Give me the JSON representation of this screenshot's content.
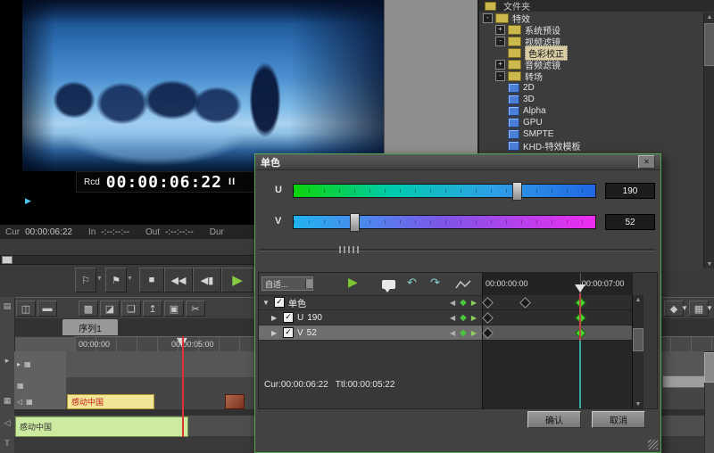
{
  "colors": {
    "dialog_border_green": "#55a555",
    "playhead_red": "#e03232",
    "keyframe_green": "#46d42e",
    "clip_yellow": "#f0e695",
    "clip_green": "#cdeba0",
    "tree_selection": "#d8cda2"
  },
  "preview": {
    "rcd_label": "Rcd",
    "timecode": "00:00:06:22",
    "pause_icon": "II",
    "left_marker_icon": "▶"
  },
  "status_bar": {
    "cur_label": "Cur",
    "cur_value": "00:00:06:22",
    "in_label": "In",
    "in_value": "-:--:--:--",
    "out_label": "Out",
    "out_value": "-:--:--:--",
    "dur_label": "Dur"
  },
  "transport": {
    "mark_in_icon": "⚐",
    "mark_out_icon": "⚑",
    "dropdown_icon": "▼",
    "stop_icon": "■",
    "rewind_icon": "◀◀",
    "step_back_icon": "◀▮",
    "play_icon": "▶",
    "step_forward_icon": "▮▶",
    "ffwd_icon": "▶▶"
  },
  "browser": {
    "title": "文件夹",
    "items": [
      {
        "label": "特效",
        "exp": "-"
      },
      {
        "label": "系统预设",
        "exp": "+"
      },
      {
        "label": "视频滤镜",
        "exp": "-"
      },
      {
        "label": "色彩校正",
        "exp": ""
      },
      {
        "label": "音频滤镜",
        "exp": "+"
      },
      {
        "label": "转场",
        "exp": "-"
      },
      {
        "label": "2D",
        "exp": ""
      },
      {
        "label": "3D",
        "exp": ""
      },
      {
        "label": "Alpha",
        "exp": ""
      },
      {
        "label": "GPU",
        "exp": ""
      },
      {
        "label": "SMPTE",
        "exp": ""
      },
      {
        "label": "KHD-特效模板",
        "exp": ""
      }
    ]
  },
  "timeline": {
    "left_icons": [
      "▤",
      "▸",
      "▦",
      "◁",
      "T"
    ],
    "toolbar_icons": [
      "◫",
      "▬",
      "▩",
      "◪",
      "❏",
      "↥",
      "▣",
      "✂"
    ],
    "right_icons": [
      "◆",
      "▼",
      "▦",
      "▼"
    ],
    "tab_label": "序列1",
    "ruler_label_1": "00:00:00",
    "ruler_label_2": "00:00:05:00",
    "video_clip_label": "感动中国",
    "audio_clip_label": "感动中国",
    "header_icons": {
      "a1": "▸",
      "a2": "▦",
      "b1": "▦",
      "c1": "◁",
      "c2": "▦"
    }
  },
  "dialog": {
    "title": "单色",
    "close_icon": "✕",
    "sliders": [
      {
        "label": "U",
        "value": "190",
        "percent": 74,
        "gradient": [
          "#0ad40a",
          "#00cbb0",
          "#2f9fe8",
          "#2166e2"
        ]
      },
      {
        "label": "V",
        "value": "52",
        "percent": 20,
        "gradient": [
          "#20b4f0",
          "#7e55e8",
          "#ef2cef"
        ]
      }
    ],
    "preset_dropdown": "自适...",
    "play_icon": "▶",
    "undo_icon": "↶",
    "redo_icon": "↷",
    "check_icon": "✓",
    "nav_prev_icon": "◀",
    "nav_key_icon": "◆",
    "nav_next_icon": "▶",
    "ruler_start": "00:00:00:00",
    "ruler_end": "00:00:07:00",
    "rows": [
      {
        "twisty": "▼",
        "label": "单色",
        "value": ""
      },
      {
        "twisty": "▶",
        "label": "U",
        "value": "190"
      },
      {
        "twisty": "▶",
        "label": "V",
        "value": "52"
      }
    ],
    "keyframes": [
      {
        "row": 0,
        "pos": 3,
        "active": false
      },
      {
        "row": 0,
        "pos": 28,
        "active": false
      },
      {
        "row": 0,
        "pos": 65,
        "active": true
      },
      {
        "row": 1,
        "pos": 3,
        "active": false
      },
      {
        "row": 1,
        "pos": 65,
        "active": true
      },
      {
        "row": 2,
        "pos": 3,
        "active": false
      },
      {
        "row": 2,
        "pos": 65,
        "active": true
      }
    ],
    "playhead_percent": 65,
    "cur_text": "Cur:00:00:06:22",
    "ttl_text": "Ttl:00:00:05:22",
    "ok_label": "确认",
    "cancel_label": "取消"
  }
}
